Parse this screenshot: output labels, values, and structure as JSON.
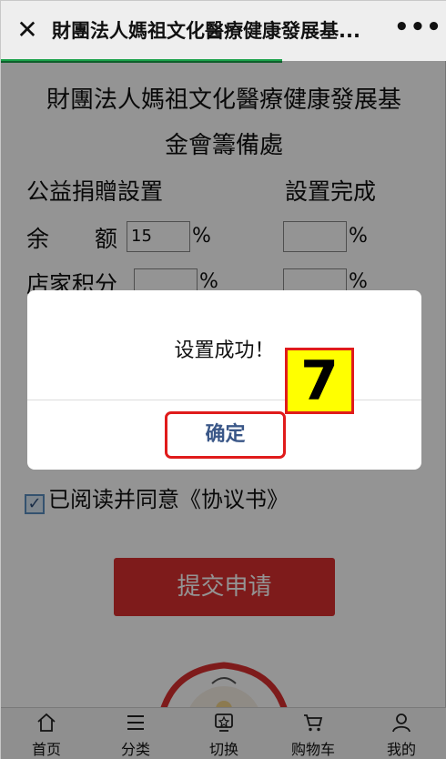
{
  "topbar": {
    "close_icon": "close-icon",
    "title": "財團法人媽祖文化醫療健康發展基...",
    "more_icon": "more-dots-icon",
    "more_label": "•••",
    "progress_fraction": 0.63
  },
  "heading": {
    "line1": "財團法人媽祖文化醫療健康發展基",
    "line2": "金會籌備處"
  },
  "sections": {
    "left_label": "公益捐贈設置",
    "right_label": "設置完成"
  },
  "rows": {
    "balance_label": "余　　额",
    "balance_value": "15",
    "store_points_label": "店家积分",
    "percent_sign": "%"
  },
  "agreement": {
    "checked": true,
    "text": "已阅读并同意《协议书》"
  },
  "submit_label": "提交申请",
  "dialog": {
    "message": "设置成功！",
    "confirm_label": "确定"
  },
  "step_badge": "7",
  "bottom_nav": {
    "items": [
      {
        "label": "首页",
        "icon": "home-icon"
      },
      {
        "label": "分类",
        "icon": "category-icon"
      },
      {
        "label": "切换",
        "icon": "switch-icon"
      },
      {
        "label": "购物车",
        "icon": "cart-icon"
      },
      {
        "label": "我的",
        "icon": "user-icon"
      }
    ]
  },
  "colors": {
    "progress": "#1aa24a",
    "submit": "#d92f2f",
    "highlight_border": "#e01b1b",
    "badge": "#ffff00",
    "confirm_text": "#3a5788"
  }
}
